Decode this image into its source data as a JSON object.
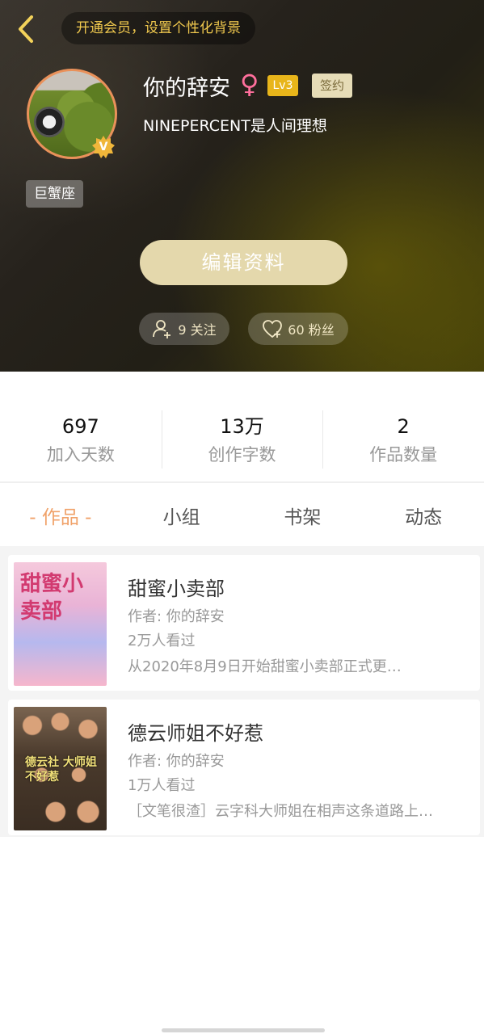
{
  "header": {
    "vip_prompt": "开通会员，设置个性化背景",
    "username": "你的辞安",
    "gender_symbol": "♀",
    "level": "Lv3",
    "signed_badge": "签约",
    "bio": "NINEPERCENT是人间理想",
    "zodiac": "巨蟹座",
    "edit_button": "编辑资料",
    "follow": "9 关注",
    "fans": "60 粉丝",
    "verified_letter": "V"
  },
  "stats": [
    {
      "value": "697",
      "label": "加入天数"
    },
    {
      "value": "13万",
      "label": "创作字数"
    },
    {
      "value": "2",
      "label": "作品数量"
    }
  ],
  "tabs": [
    {
      "label": "- 作品 -",
      "active": true
    },
    {
      "label": "小组"
    },
    {
      "label": "书架"
    },
    {
      "label": "动态"
    }
  ],
  "books": [
    {
      "cover_text": "甜蜜小卖部",
      "title": "甜蜜小卖部",
      "author": "作者: 你的辞安",
      "reads": "2万人看过",
      "description": "从2020年8月9日开始甜蜜小卖部正式更…"
    },
    {
      "cover_text": "德云社 大师姐不好惹",
      "title": "德云师姐不好惹",
      "author": "作者: 你的辞安",
      "reads": "1万人看过",
      "description": "［文笔很渣］云字科大师姐在相声这条道路上…"
    }
  ],
  "colors": {
    "accent_orange": "#f0a26a",
    "gold": "#e8b51a",
    "edit_button_bg": "#e4d8ac"
  }
}
